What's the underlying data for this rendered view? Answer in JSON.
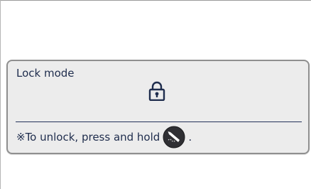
{
  "dialog": {
    "title": "Lock mode",
    "lock_icon": "lock-icon",
    "hint_prefix": "※To unlock, press and hold",
    "hint_key_icon": "pen-key-icon",
    "hint_suffix": "."
  },
  "colors": {
    "text": "#1f2d4d",
    "dialog_bg": "#ececec",
    "dialog_border": "#8f8f8f",
    "divider": "#24335a",
    "key_badge": "#2f2f33"
  }
}
